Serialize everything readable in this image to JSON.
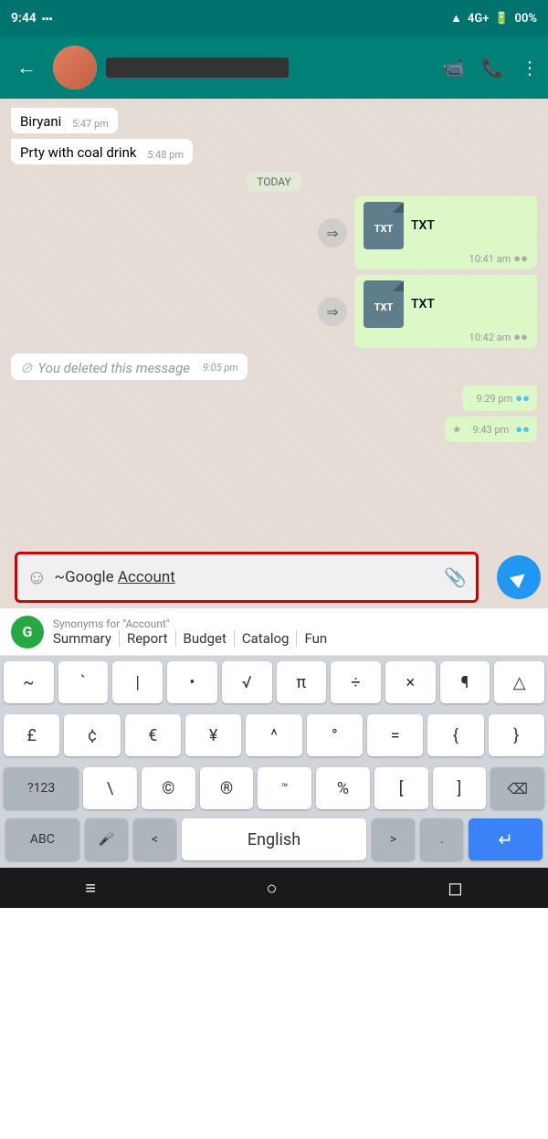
{
  "statusBar": {
    "time": "9:44",
    "signal": "4G+",
    "battery": "00%"
  },
  "header": {
    "name": "",
    "icons": {
      "video": "📹",
      "phone": "📞",
      "more": "⋮"
    }
  },
  "chat": {
    "messages": [
      {
        "id": "msg1",
        "type": "received",
        "text": "Biryani",
        "time": "5:47 pm",
        "ticks": ""
      },
      {
        "id": "msg2",
        "type": "received",
        "text": "Prty with coal drink",
        "time": "5:48 pm",
        "ticks": ""
      },
      {
        "id": "divider",
        "type": "divider",
        "text": "TODAY"
      },
      {
        "id": "msg3",
        "type": "sent-file",
        "fileName": "TXT",
        "time": "10:41 am",
        "ticks": "●●"
      },
      {
        "id": "msg4",
        "type": "sent-file",
        "fileName": "TXT",
        "time": "10:42 am",
        "ticks": "●●"
      },
      {
        "id": "msg5",
        "type": "deleted",
        "text": "You deleted this message",
        "time": "9:05 pm"
      },
      {
        "id": "msg6",
        "type": "sent-empty",
        "time": "9:29 pm",
        "ticks": "●●"
      },
      {
        "id": "msg7",
        "type": "sent-star",
        "time": "9:43 pm",
        "ticks": "●●"
      }
    ]
  },
  "inputBar": {
    "emoji": "☺",
    "text": "~Google Account",
    "attach": "📎",
    "send": "▶"
  },
  "grammarly": {
    "logo": "G",
    "synonymsLabel": "Synonyms for \"Account\"",
    "synonyms": [
      "Summary",
      "Report",
      "Budget",
      "Catalog",
      "Fun"
    ]
  },
  "keyboard": {
    "row1": [
      "~",
      "`",
      "|",
      "•",
      "√",
      "π",
      "÷",
      "×",
      "¶",
      "△"
    ],
    "row2": [
      "£",
      "¢",
      "€",
      "¥",
      "^",
      "°",
      "=",
      "{",
      "}"
    ],
    "row3Left": "?123",
    "row3Keys": [
      "\\",
      "©",
      "®",
      "™",
      "%",
      "[",
      "]"
    ],
    "row3Right": "⌫",
    "bottomLeft": "ABC",
    "bottomMic": "🎤",
    "bottomLt": "<",
    "bottomSpace": "English",
    "bottomGt": ">",
    "bottomDot": ".",
    "bottomEnter": "↵"
  },
  "navBar": {
    "menu": "≡",
    "home": "○",
    "back": "◻"
  }
}
